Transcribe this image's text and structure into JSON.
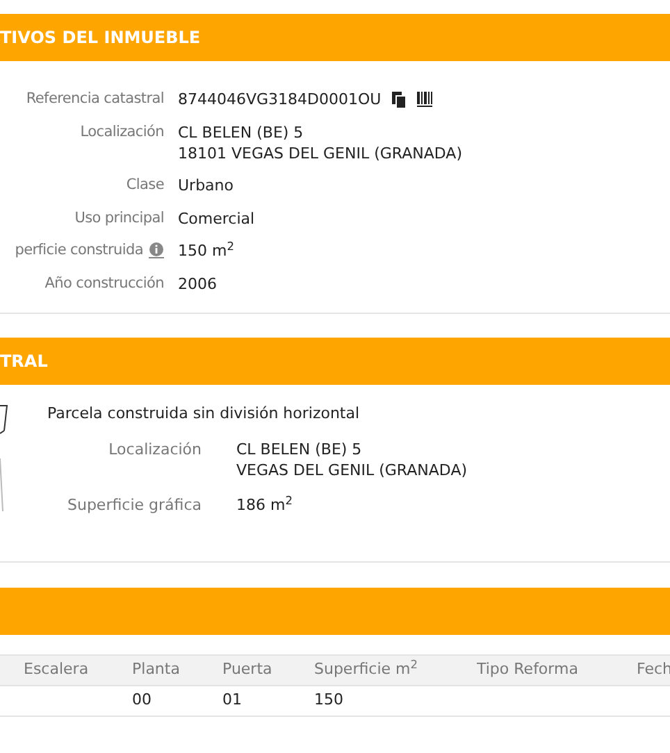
{
  "property_panel": {
    "title": "TIVOS DEL INMUEBLE",
    "rows": [
      {
        "kind": "reference",
        "label": "Referencia catastral",
        "lines": [
          "8744046VG3184D0001OU"
        ]
      },
      {
        "kind": "text",
        "label": "Localización",
        "lines": [
          "CL BELEN (BE) 5",
          "18101 VEGAS DEL GENIL (GRANADA)"
        ]
      },
      {
        "kind": "text",
        "label": "Clase",
        "lines": [
          "Urbano"
        ]
      },
      {
        "kind": "text",
        "label": "Uso principal",
        "lines": [
          "Comercial"
        ]
      },
      {
        "kind": "info",
        "label": "perficie construida",
        "lines": [
          "150 m$^{2}$"
        ]
      },
      {
        "kind": "text",
        "label": "Año construcción",
        "lines": [
          "2006"
        ]
      }
    ]
  },
  "parcel_panel": {
    "title": "TRAL",
    "description": "Parcela construida sin división horizontal",
    "rows": [
      {
        "label": "Localización",
        "lines": [
          "CL BELEN (BE) 5",
          "VEGAS DEL GENIL (GRANADA)"
        ]
      },
      {
        "label": "Superficie gráfica",
        "lines": [
          "186 m$^{2}$"
        ]
      }
    ]
  },
  "units_panel": {
    "table": {
      "columns": [
        "Escalera",
        "Planta",
        "Puerta",
        "Superficie m$^{2}$",
        "Tipo Reforma",
        "Fech"
      ],
      "rows": [
        [
          "",
          "00",
          "01",
          "150",
          "",
          ""
        ]
      ]
    }
  }
}
